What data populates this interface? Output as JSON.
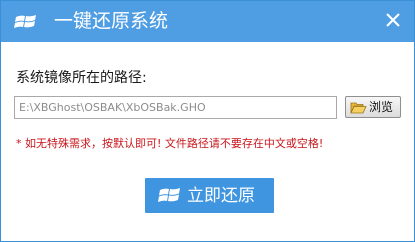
{
  "window": {
    "title": "一键还原系统",
    "colors": {
      "titlebar": "#4f9ee3",
      "accent_button": "#3f95df",
      "note_text": "#c8151b"
    }
  },
  "title_icons": {
    "logo": "windows-logo-icon",
    "close": "close-icon"
  },
  "form": {
    "path_label": "系统镜像所在的路径:",
    "path_placeholder": "E:\\XBGhost\\OSBAK\\XbOSBak.GHO",
    "browse_label": "浏览",
    "browse_icon": "folder-open-icon",
    "note": "* 如无特殊需求，按默认即可! 文件路径请不要存在中文或空格!"
  },
  "actions": {
    "restore_label": "立即还原",
    "restore_icon": "windows-logo-icon"
  }
}
